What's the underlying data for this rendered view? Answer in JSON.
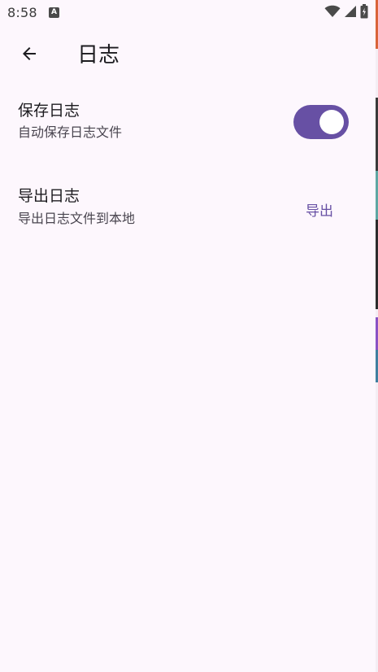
{
  "status_bar": {
    "time": "8:58",
    "notification_icon": "a-letter-icon",
    "icons": [
      "wifi-icon",
      "signal-icon",
      "battery-icon"
    ]
  },
  "app_bar": {
    "back_icon": "arrow-back-icon",
    "title": "日志"
  },
  "settings": {
    "save_log": {
      "title": "保存日志",
      "subtitle": "自动保存日志文件",
      "enabled": true
    },
    "export_log": {
      "title": "导出日志",
      "subtitle": "导出日志文件到本地",
      "button_label": "导出"
    }
  },
  "colors": {
    "background": "#fdf7fd",
    "accent": "#6750a4",
    "text_primary": "#1c1b1f",
    "text_secondary": "#49454f"
  }
}
